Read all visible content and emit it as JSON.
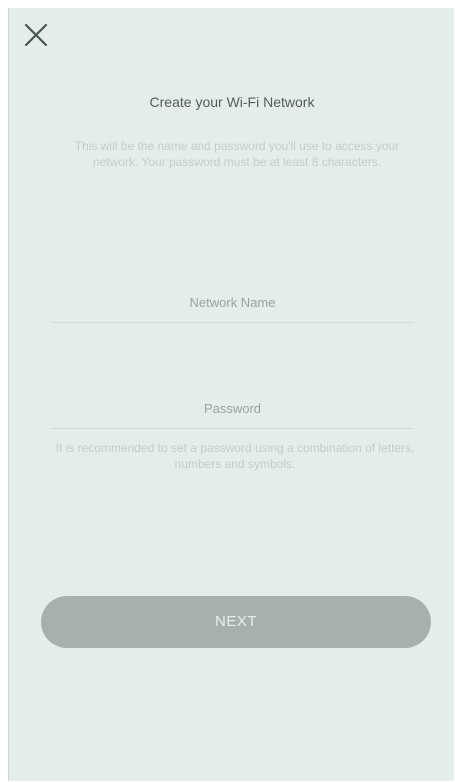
{
  "header": {
    "close_icon": "close-icon",
    "title": "Create your Wi-Fi Network",
    "subtitle": "This will be the name and password you'll use to access your network. Your password must be at least 8 characters."
  },
  "form": {
    "network_name": {
      "value": "",
      "placeholder": "Network Name"
    },
    "password": {
      "value": "",
      "placeholder": "Password"
    },
    "hint": "It is recommended to set a password using a combination of letters, numbers and symbols."
  },
  "actions": {
    "next_label": "NEXT"
  },
  "colors": {
    "background": "#e3eeeb",
    "button_disabled": "#a8b0ae",
    "button_text": "#e9eeec",
    "title_text": "#555c5a",
    "muted_text": "#c5ccca"
  }
}
